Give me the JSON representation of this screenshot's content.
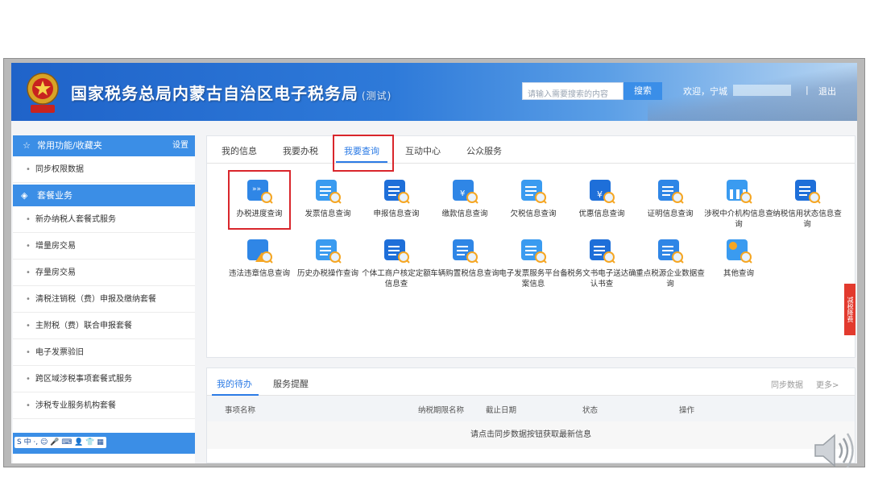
{
  "header": {
    "title": "国家税务总局内蒙古自治区电子税务局",
    "subtitle": "(测试)",
    "search_placeholder": "请输入需要搜索的内容",
    "search_button": "搜索",
    "welcome": "欢迎，宁城",
    "separator": "|",
    "logout": "退出"
  },
  "sidebar": {
    "favorites_header": "常用功能/收藏夹",
    "favorites_setting": "设置",
    "favorites_items": [
      "同步权限数据"
    ],
    "packages_header": "套餐业务",
    "package_items": [
      "新办纳税人套餐式服务",
      "增量房交易",
      "存量房交易",
      "清税注销税（费）申报及缴纳套餐",
      "主附税（费）联合申报套餐",
      "电子发票验旧",
      "跨区域涉税事项套餐式服务",
      "涉税专业服务机构套餐"
    ],
    "ime": "S 中 ·, ☺ 🎤 ⌨ 👤 👕 ▦"
  },
  "tabs": [
    "我的信息",
    "我要办税",
    "我要查询",
    "互动中心",
    "公众服务"
  ],
  "active_tab": "我要查询",
  "query_items": [
    {
      "label": "办税进度查询",
      "icon": "progress-query-icon"
    },
    {
      "label": "发票信息查询",
      "icon": "invoice-query-icon"
    },
    {
      "label": "申报信息查询",
      "icon": "declare-query-icon"
    },
    {
      "label": "缴款信息查询",
      "icon": "payment-query-icon"
    },
    {
      "label": "欠税信息查询",
      "icon": "arrears-query-icon"
    },
    {
      "label": "优惠信息查询",
      "icon": "discount-query-icon"
    },
    {
      "label": "证明信息查询",
      "icon": "certificate-query-icon"
    },
    {
      "label": "涉税中介机构信息查询",
      "icon": "agency-query-icon"
    },
    {
      "label": "纳税信用状态信息查询",
      "icon": "credit-query-icon"
    },
    {
      "label": "违法违章信息查询",
      "icon": "violation-query-icon"
    },
    {
      "label": "历史办税操作查询",
      "icon": "history-query-icon"
    },
    {
      "label": "个体工商户核定定额信息查",
      "icon": "business-query-icon"
    },
    {
      "label": "车辆购置税信息查询",
      "icon": "vehicle-query-icon"
    },
    {
      "label": "电子发票服务平台备案信息",
      "icon": "e-invoice-query-icon"
    },
    {
      "label": "税务文书电子送达确认书查",
      "icon": "document-query-icon"
    },
    {
      "label": "重点税源企业数据查询",
      "icon": "key-source-query-icon"
    },
    {
      "label": "其他查询",
      "icon": "other-query-icon"
    }
  ],
  "todo": {
    "tabs": [
      "我的待办",
      "服务提醒"
    ],
    "sync": "同步数据",
    "more": "更多>",
    "columns": [
      "事项名称",
      "纳税期限名称",
      "截止日期",
      "状态",
      "操作"
    ],
    "empty_message": "请点击同步数据按钮获取最新信息"
  },
  "right_badge": "减税降费",
  "colors": {
    "accent": "#2c7be5",
    "header": "#1f63c9",
    "highlight": "#d9262c"
  }
}
